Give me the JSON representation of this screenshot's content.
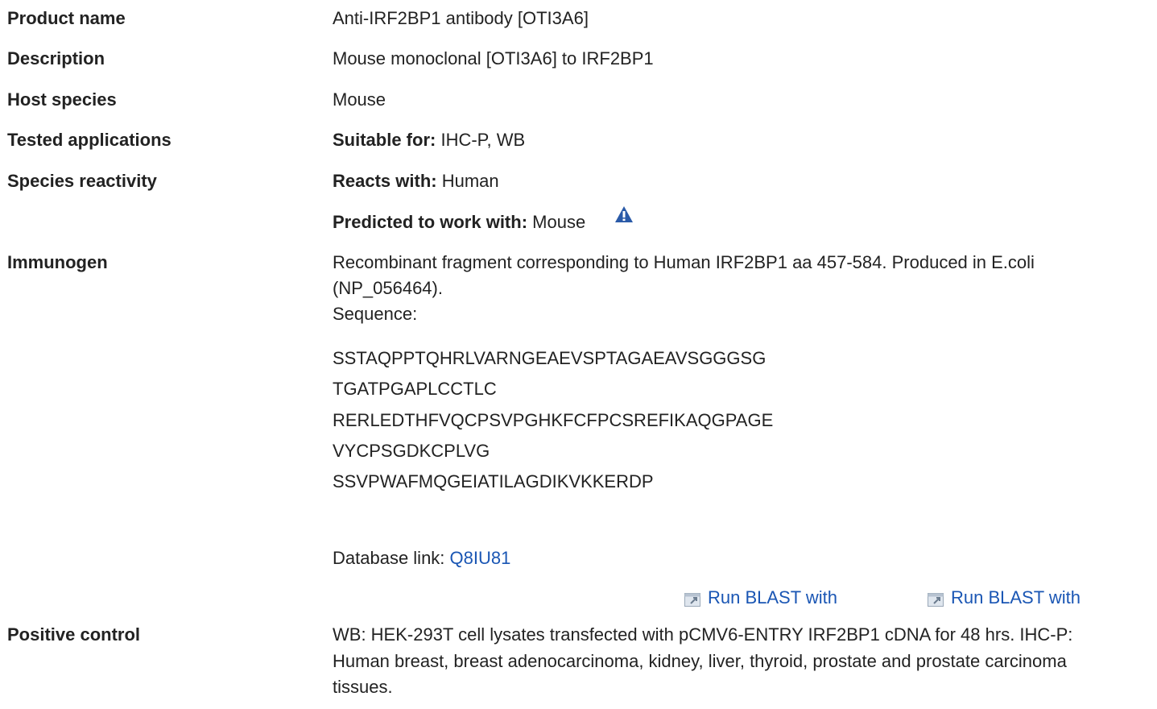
{
  "rows": {
    "product_name": {
      "label": "Product name",
      "value": "Anti-IRF2BP1 antibody [OTI3A6]"
    },
    "description": {
      "label": "Description",
      "value": "Mouse monoclonal [OTI3A6] to IRF2BP1"
    },
    "host_species": {
      "label": "Host species",
      "value": "Mouse"
    },
    "tested_applications": {
      "label": "Tested applications",
      "prefix": "Suitable for:",
      "value": "IHC-P, WB"
    },
    "species_reactivity": {
      "label": "Species reactivity",
      "reacts_prefix": "Reacts with:",
      "reacts_value": "Human",
      "predicted_prefix": "Predicted to work with:",
      "predicted_value": "Mouse",
      "predicted_icon": "warning-icon"
    },
    "immunogen": {
      "label": "Immunogen",
      "line1": "Recombinant fragment corresponding to Human IRF2BP1 aa 457-584. Produced in E.coli",
      "line2": "(NP_056464).",
      "sequence_label": "Sequence:",
      "sequence": [
        "SSTAQPPTQHRLVARNGEAEVSPTAGAEAVSGGGSG",
        "TGATPGAPLCCTLC",
        "RERLEDTHFVQCPSVPGHKFCFPCSREFIKAQGPAGE",
        "VYCPSGDKCPLVG",
        "SSVPWAFMQGEIATILAGDIKVKKERDP"
      ],
      "database_prefix": "Database link:",
      "database_link": "Q8IU81",
      "blast_links": [
        "Run BLAST with",
        "Run BLAST with"
      ],
      "blast_icon": "external-window-icon"
    },
    "positive_control": {
      "label": "Positive control",
      "line1": "WB: HEK-293T cell lysates transfected with pCMV6-ENTRY IRF2BP1 cDNA for 48 hrs. IHC-P:",
      "line2": "Human breast, breast adenocarcinoma, kidney, liver, thyroid, prostate and prostate carcinoma",
      "line3": "tissues."
    }
  },
  "colors": {
    "text": "#222222",
    "link": "#1a56b4",
    "warning_icon": "#2a5aa8"
  }
}
